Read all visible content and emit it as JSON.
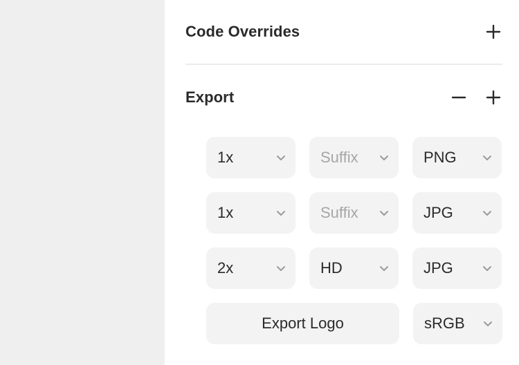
{
  "sections": {
    "code_overrides": {
      "title": "Code Overrides",
      "add_icon": "plus-icon"
    },
    "export": {
      "title": "Export",
      "remove_icon": "minus-icon",
      "add_icon": "plus-icon"
    }
  },
  "export_rows": [
    {
      "scale": "1x",
      "suffix_value": "",
      "suffix_placeholder": "Suffix",
      "format": "PNG"
    },
    {
      "scale": "1x",
      "suffix_value": "",
      "suffix_placeholder": "Suffix",
      "format": "JPG"
    },
    {
      "scale": "2x",
      "suffix_value": "HD",
      "suffix_placeholder": "Suffix",
      "format": "JPG"
    }
  ],
  "export_footer": {
    "button_label": "Export Logo",
    "color_profile": "sRGB"
  },
  "icons": {
    "dropdown": "chevron-down-icon"
  },
  "colors": {
    "panel_bg": "#ffffff",
    "canvas_bg": "#efefef",
    "control_bg": "#f3f3f3",
    "text": "#2a2a2a",
    "placeholder_text": "#a6a6a6",
    "divider": "#ececec"
  }
}
